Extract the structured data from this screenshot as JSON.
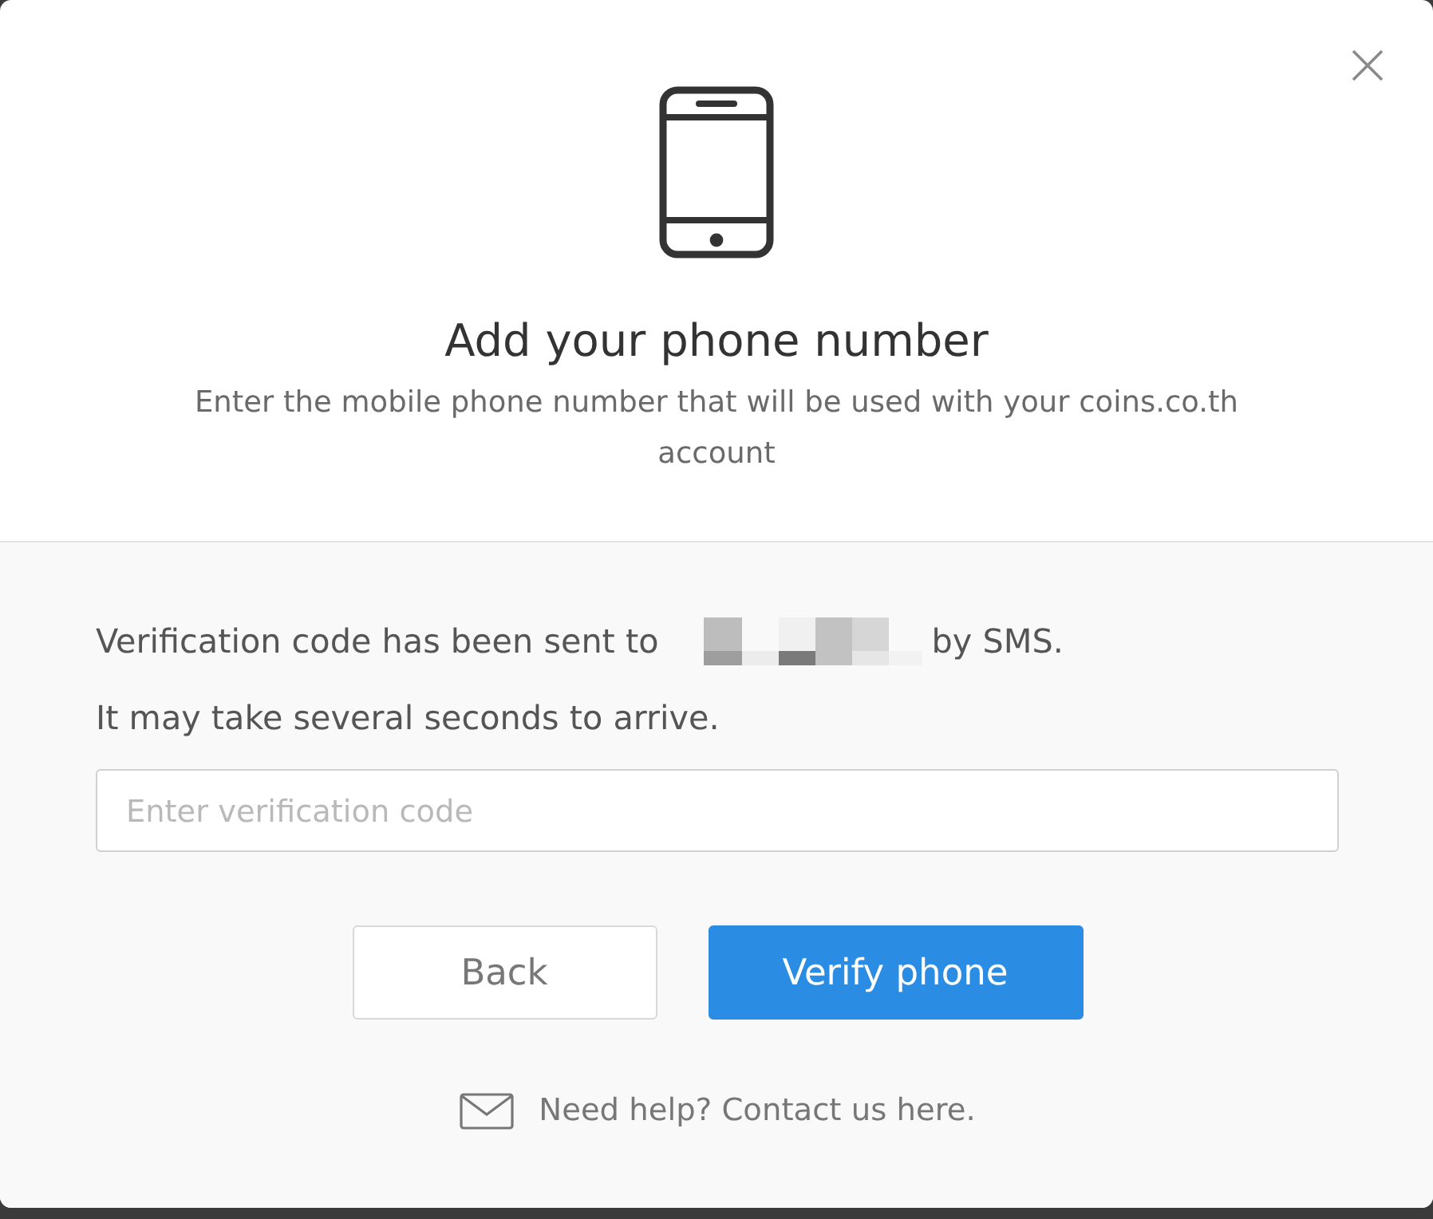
{
  "header": {
    "title": "Add your phone number",
    "subtitle": "Enter the mobile phone number that will be used with your coins.co.th account"
  },
  "body": {
    "message_before": "Verification code has been sent to",
    "message_after": "by SMS.",
    "note": "It may take several seconds to arrive.",
    "code_field": {
      "placeholder": "Enter verification code"
    }
  },
  "buttons": [
    {
      "label": "Back",
      "kind": "secondary"
    },
    {
      "label": "Verify phone",
      "kind": "primary"
    }
  ],
  "help": {
    "text": "Need help? Contact us here."
  }
}
